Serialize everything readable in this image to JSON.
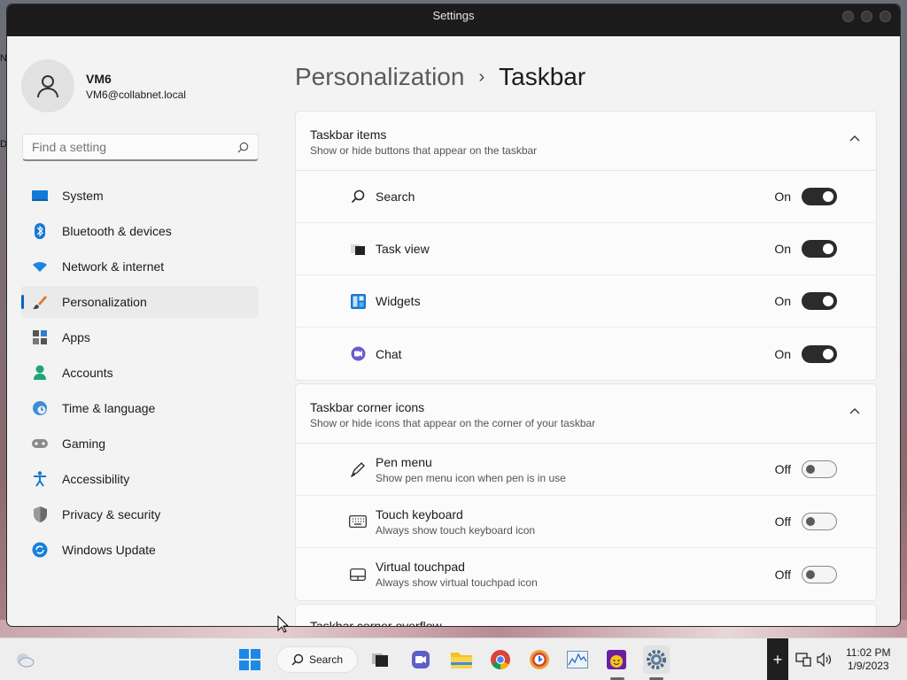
{
  "window": {
    "title": "Settings"
  },
  "profile": {
    "name": "VM6",
    "email": "VM6@collabnet.local"
  },
  "search": {
    "placeholder": "Find a setting"
  },
  "sidebar": {
    "items": [
      {
        "label": "System",
        "icon": "system-icon"
      },
      {
        "label": "Bluetooth & devices",
        "icon": "bluetooth-icon"
      },
      {
        "label": "Network & internet",
        "icon": "wifi-icon"
      },
      {
        "label": "Personalization",
        "icon": "brush-icon",
        "active": true
      },
      {
        "label": "Apps",
        "icon": "apps-icon"
      },
      {
        "label": "Accounts",
        "icon": "person-icon"
      },
      {
        "label": "Time & language",
        "icon": "clock-globe-icon"
      },
      {
        "label": "Gaming",
        "icon": "gamepad-icon"
      },
      {
        "label": "Accessibility",
        "icon": "accessibility-icon"
      },
      {
        "label": "Privacy & security",
        "icon": "shield-icon"
      },
      {
        "label": "Windows Update",
        "icon": "update-icon"
      }
    ]
  },
  "breadcrumb": {
    "parent": "Personalization",
    "separator": "›",
    "current": "Taskbar"
  },
  "sections": [
    {
      "title": "Taskbar items",
      "subtitle": "Show or hide buttons that appear on the taskbar",
      "rows": [
        {
          "label": "Search",
          "state": "On",
          "icon": "search-icon"
        },
        {
          "label": "Task view",
          "state": "On",
          "icon": "task-view-icon"
        },
        {
          "label": "Widgets",
          "state": "On",
          "icon": "widgets-icon"
        },
        {
          "label": "Chat",
          "state": "On",
          "icon": "chat-icon"
        }
      ]
    },
    {
      "title": "Taskbar corner icons",
      "subtitle": "Show or hide icons that appear on the corner of your taskbar",
      "rows": [
        {
          "label": "Pen menu",
          "desc": "Show pen menu icon when pen is in use",
          "state": "Off",
          "icon": "pen-icon"
        },
        {
          "label": "Touch keyboard",
          "desc": "Always show touch keyboard icon",
          "state": "Off",
          "icon": "keyboard-icon"
        },
        {
          "label": "Virtual touchpad",
          "desc": "Always show virtual touchpad icon",
          "state": "Off",
          "icon": "touchpad-icon"
        }
      ]
    },
    {
      "title": "Taskbar corner overflow"
    }
  ],
  "taskbar": {
    "search_label": "Search",
    "time": "11:02 PM",
    "date": "1/9/2023",
    "plus": "+"
  },
  "colors": {
    "accent": "#0067c0",
    "toggle_on": "#2b2b2b",
    "titlebar": "#1c1c1c"
  }
}
